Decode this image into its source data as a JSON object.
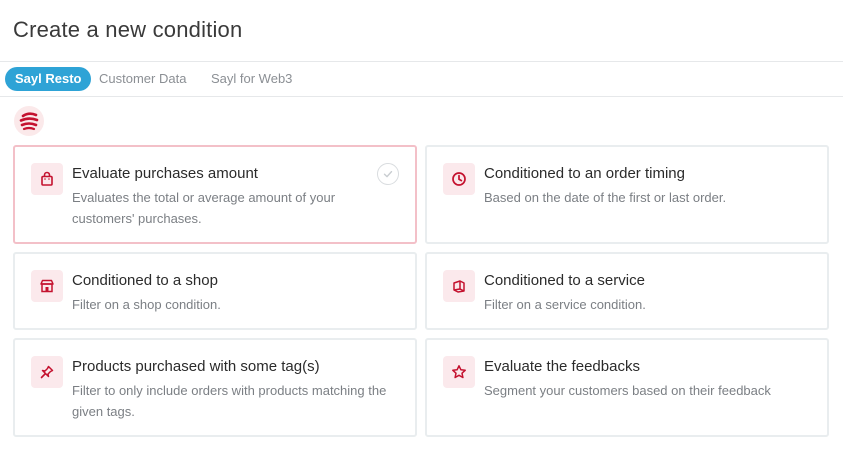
{
  "page": {
    "title": "Create a new condition"
  },
  "tabs": [
    {
      "label": "Sayl Resto",
      "active": true
    },
    {
      "label": "Customer Data",
      "active": false
    },
    {
      "label": "Sayl for Web3",
      "active": false
    }
  ],
  "colors": {
    "accent": "#2ea3d6",
    "brand": "#c4122f",
    "icon_bg": "#fbe9ec",
    "selected_border": "#f3c0c8"
  },
  "logo": {
    "icon": "sayl-resto-logo"
  },
  "cards": [
    {
      "icon": "shopping-bag-icon",
      "title": "Evaluate purchases amount",
      "description": "Evaluates the total or average amount of your customers' purchases.",
      "selected": true
    },
    {
      "icon": "clock-icon",
      "title": "Conditioned to an order timing",
      "description": "Based on the date of the first or last order.",
      "selected": false
    },
    {
      "icon": "shop-icon",
      "title": "Conditioned to a shop",
      "description": "Filter on a shop condition.",
      "selected": false
    },
    {
      "icon": "service-icon",
      "title": "Conditioned to a service",
      "description": "Filter on a service condition.",
      "selected": false
    },
    {
      "icon": "pin-icon",
      "title": "Products purchased with some tag(s)",
      "description": "Filter to only include orders with products matching the given tags.",
      "selected": false
    },
    {
      "icon": "star-icon",
      "title": "Evaluate the feedbacks",
      "description": "Segment your customers based on their feedback",
      "selected": false
    }
  ]
}
